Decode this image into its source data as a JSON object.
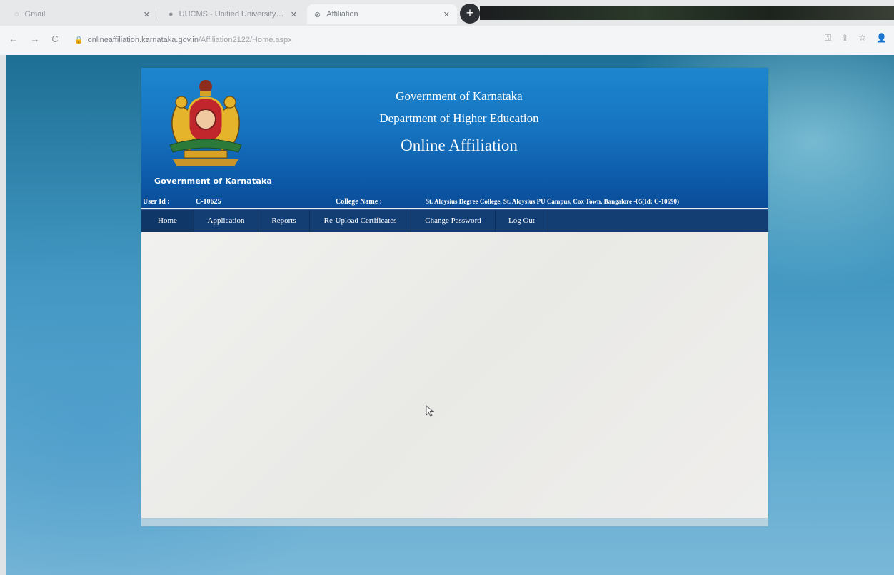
{
  "browser": {
    "tabs": [
      {
        "title": "Gmail",
        "close": "✕"
      },
      {
        "title": "UUCMS - Unified University Col",
        "close": "✕"
      },
      {
        "title": "Affiliation",
        "close": "✕"
      }
    ],
    "new_tab": "+",
    "url_host": "onlineaffiliation.karnataka.gov.in",
    "url_path": "/Affiliation2122/Home.aspx"
  },
  "header": {
    "gov_label": "Government of Karnataka",
    "line1": "Government of Karnataka",
    "line2": "Department of Higher Education",
    "line3": "Online Affiliation"
  },
  "info": {
    "user_id_label": "User Id :",
    "user_id_value": "C-10625",
    "college_label": "College Name :",
    "college_value": "St. Aloysius Degree College, St. Aloysius PU Campus, Cox Town, Bangalore -05(Id: C-10690)"
  },
  "nav": {
    "items": [
      "Home",
      "Application",
      "Reports",
      "Re-Upload Certificates",
      "Change Password",
      "Log Out"
    ]
  },
  "colors": {
    "header_top": "#1d86cf",
    "header_bottom": "#0a4c97",
    "navbar": "#123e73"
  }
}
